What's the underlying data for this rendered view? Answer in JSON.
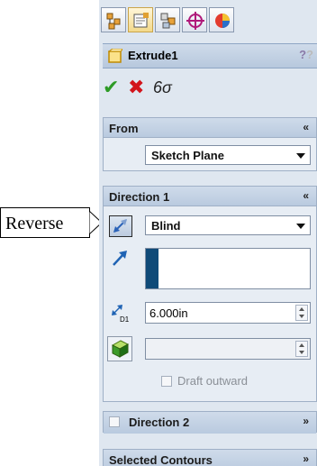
{
  "toolbar": {
    "tabs": [
      "feature-manager-icon",
      "property-manager-icon",
      "configuration-manager-icon",
      "dimxpert-icon",
      "display-manager-icon"
    ]
  },
  "feature": {
    "title": "Extrude1",
    "help": "?"
  },
  "actions": {
    "ok": "✔",
    "cancel": "✖",
    "preview": "6σ"
  },
  "from_group": {
    "label": "From",
    "selection": "Sketch Plane"
  },
  "direction1": {
    "label": "Direction 1",
    "end_condition": "Blind",
    "depth": "6.000in",
    "draft_outward_label": "Draft outward"
  },
  "direction2": {
    "label": "Direction 2"
  },
  "selected_contours": {
    "label": "Selected Contours"
  },
  "callout": {
    "label": "Reverse"
  },
  "colors": {
    "panel_bg": "#dfe7f0",
    "header": "#b9cadf",
    "accent_blue": "#0f4a78"
  }
}
